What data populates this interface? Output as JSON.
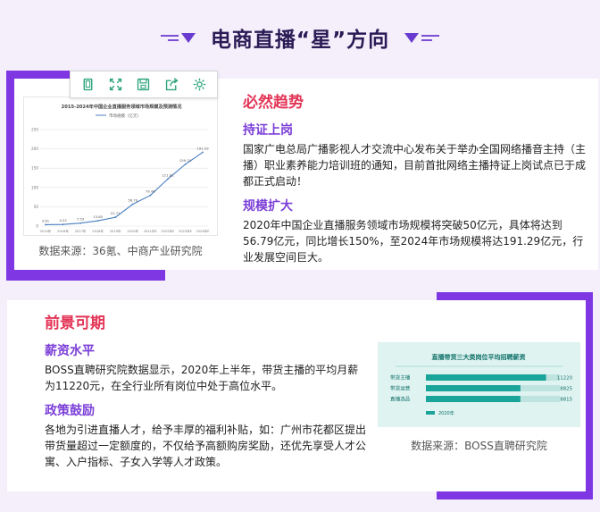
{
  "header": {
    "title": "电商直播“星”方向"
  },
  "section1": {
    "heading": "必然趋势",
    "blocks": [
      {
        "title": "持证上岗",
        "text": "国家广电总局广播影视人才交流中心发布关于举办全国网络播音主持（主播）职业素养能力培训班的通知，目前首批网络主播持证上岗试点已于成都正式启动！"
      },
      {
        "title": "规模扩大",
        "text": "2020年中国企业直播服务领域市场规模将突破50亿元，具体将达到56.79亿元，同比增长150%，至2024年市场规模将达191.29亿元，行业发展空间巨大。"
      }
    ],
    "source": "数据来源：36氪、中商产业研究院",
    "toolbar": [
      "document-icon",
      "expand-icon",
      "save-icon",
      "share-icon",
      "settings-icon"
    ]
  },
  "section2": {
    "heading": "前景可期",
    "blocks": [
      {
        "title": "薪资水平",
        "text": "BOSS直聘研究院数据显示，2020年上半年，带货主播的平均月薪为11220元，在全行业所有岗位中处于高位水平。"
      },
      {
        "title": "政策鼓励",
        "text": "各地为引进直播人才，给予丰厚的福利补贴，如：广州市花都区提出带货量超过一定额度的，不仅给予高额购房奖励，还优先享受人才公寓、入户指标、子女入学等人才政策。"
      }
    ],
    "source": "数据来源：BOSS直聘研究院"
  },
  "colors": {
    "accent": "#7e37e3",
    "red": "#e33456",
    "purple": "#7c3fd8",
    "teal": "#1aa59a"
  },
  "chart_data": [
    {
      "type": "line",
      "title": "2015-2024年中国企业直播服务领域市场规模及预测情况",
      "legend": "市场规模（亿元）",
      "categories": [
        "2015年",
        "2016年",
        "2017年",
        "2018年",
        "2019年",
        "2020年",
        "2021年E",
        "2022年E",
        "2023年E",
        "2024年E"
      ],
      "values": [
        3.61,
        4.22,
        7.53,
        13.65,
        22.71,
        56.79,
        79.46,
        121.81,
        159.74,
        191.29
      ],
      "value_labels": [
        "3.61",
        "4.22",
        "7.53",
        "13.65",
        "22.71",
        "56.79",
        "79.46",
        "121.81",
        "159.74",
        "191.29"
      ],
      "ylim": [
        0,
        250
      ],
      "yticks": [
        "0",
        "50",
        "100",
        "150",
        "200",
        "250"
      ],
      "grid": true
    },
    {
      "type": "bar",
      "title": "直播带货三大类岗位平均招聘薪资",
      "categories": [
        "带货主播",
        "带货运营",
        "直播选品"
      ],
      "values": [
        11220,
        8825,
        8815
      ],
      "value_labels": [
        "11220",
        "8825",
        "8815"
      ],
      "legend": "2020年"
    }
  ]
}
